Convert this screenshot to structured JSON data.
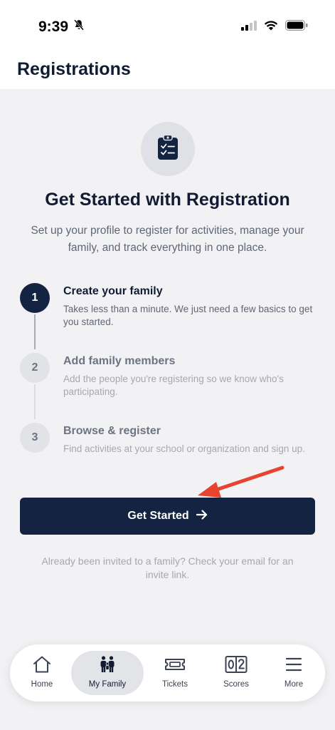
{
  "status_bar": {
    "time": "9:39"
  },
  "header": {
    "title": "Registrations"
  },
  "hero": {
    "icon": "clipboard-check-icon",
    "title": "Get Started with Registration",
    "subtitle": "Set up your profile to register for activities, manage your family, and track everything in one place."
  },
  "steps": [
    {
      "number": "1",
      "title": "Create your family",
      "description": "Takes less than a minute. We just need a few basics to get you started.",
      "state": "active"
    },
    {
      "number": "2",
      "title": "Add family members",
      "description": "Add the people you're registering so we know who's participating.",
      "state": "inactive"
    },
    {
      "number": "3",
      "title": "Browse & register",
      "description": "Find activities at your school or organization and sign up.",
      "state": "inactive"
    }
  ],
  "cta": {
    "label": "Get Started",
    "icon": "arrow-right-icon"
  },
  "invite_note": "Already been invited to a family? Check your email for an invite link.",
  "tab_bar": {
    "items": [
      {
        "label": "Home",
        "icon": "home-icon"
      },
      {
        "label": "My Family",
        "icon": "family-icon",
        "selected": true
      },
      {
        "label": "Tickets",
        "icon": "ticket-icon"
      },
      {
        "label": "Scores",
        "icon": "scoreboard-icon"
      },
      {
        "label": "More",
        "icon": "menu-icon"
      }
    ]
  },
  "colors": {
    "primary": "#132341",
    "background": "#f2f2f4",
    "annotation_arrow": "#e8432e"
  }
}
